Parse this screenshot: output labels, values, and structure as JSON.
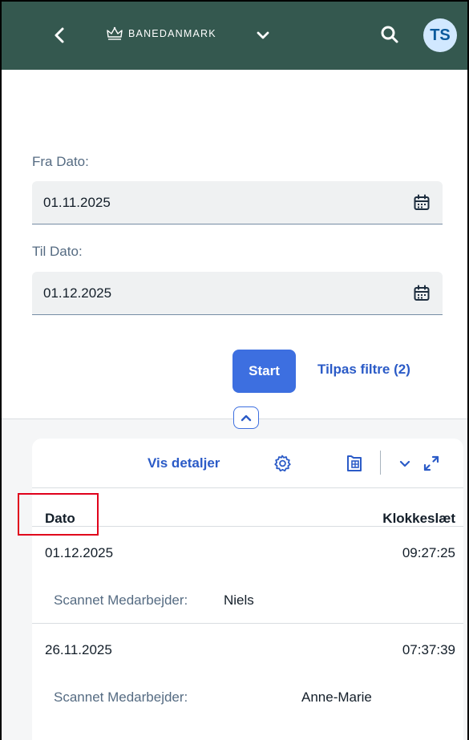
{
  "header": {
    "brand": "BANEDANMARK",
    "avatar_initials": "TS",
    "icons": [
      "back-icon",
      "crown-icon",
      "chevron-down-icon",
      "search-icon"
    ],
    "bg_color": "#34584f"
  },
  "filters": {
    "from_label": "Fra Dato:",
    "from_value": "01.11.2025",
    "to_label": "Til Dato:",
    "to_value": "01.12.2025",
    "start_label": "Start",
    "adapt_label": "Tilpas filtre (2)"
  },
  "table": {
    "toolbar": {
      "details_label": "Vis detaljer",
      "icons": [
        "settings-icon",
        "export-icon",
        "chevron-down-icon",
        "fullscreen-icon"
      ]
    },
    "columns": [
      "Dato",
      "Klokkeslæt"
    ],
    "rows": [
      {
        "date": "01.12.2025",
        "time": "09:27:25",
        "sub_label": "Scannet Medarbejder:",
        "sub_value": "Niels"
      },
      {
        "date": "26.11.2025",
        "time": "07:37:39",
        "sub_label": "Scannet Medarbejder:",
        "sub_value": "Anne-Marie"
      }
    ]
  },
  "colors": {
    "accent": "#3d6fe0",
    "highlight": "#e0001b"
  }
}
